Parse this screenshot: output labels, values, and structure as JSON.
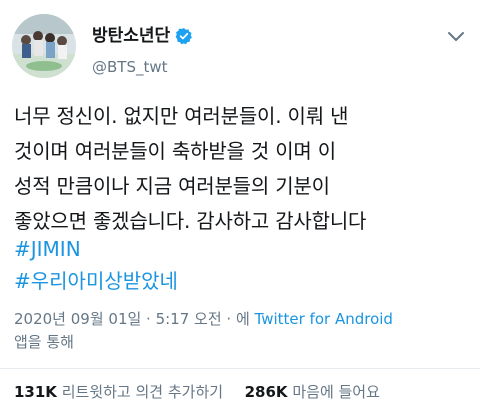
{
  "profile": {
    "display_name": "방탄소년단",
    "handle": "@BTS_twt",
    "avatar_icon": "profile-photo",
    "verified_icon": "verified-badge-icon",
    "verified_color": "#1da1f2"
  },
  "tweet": {
    "text": "너무 정신이. 없지만 여러분들이. 이뤄 낸\n것이며 여러분들이 축하받을 것 이며 이\n성적 만큼이나 지금 여러분들의 기분이\n좋았으면 좋겠습니다. 감사하고 감사합니다",
    "hashtags": [
      "#JIMIN",
      "#우리아미상받았네"
    ]
  },
  "meta": {
    "datetime": "2020년 09월 01일 · 5:17 오전 · 에 ",
    "source": "Twitter for Android",
    "suffix": "앱을 통해"
  },
  "stats": {
    "retweets_count": "131K",
    "retweets_label": "리트윗하고 의견 추가하기",
    "likes_count": "286K",
    "likes_label": "마음에 들어요"
  },
  "colors": {
    "link": "#1b95e0",
    "secondary": "#657786",
    "text": "#14171a"
  }
}
